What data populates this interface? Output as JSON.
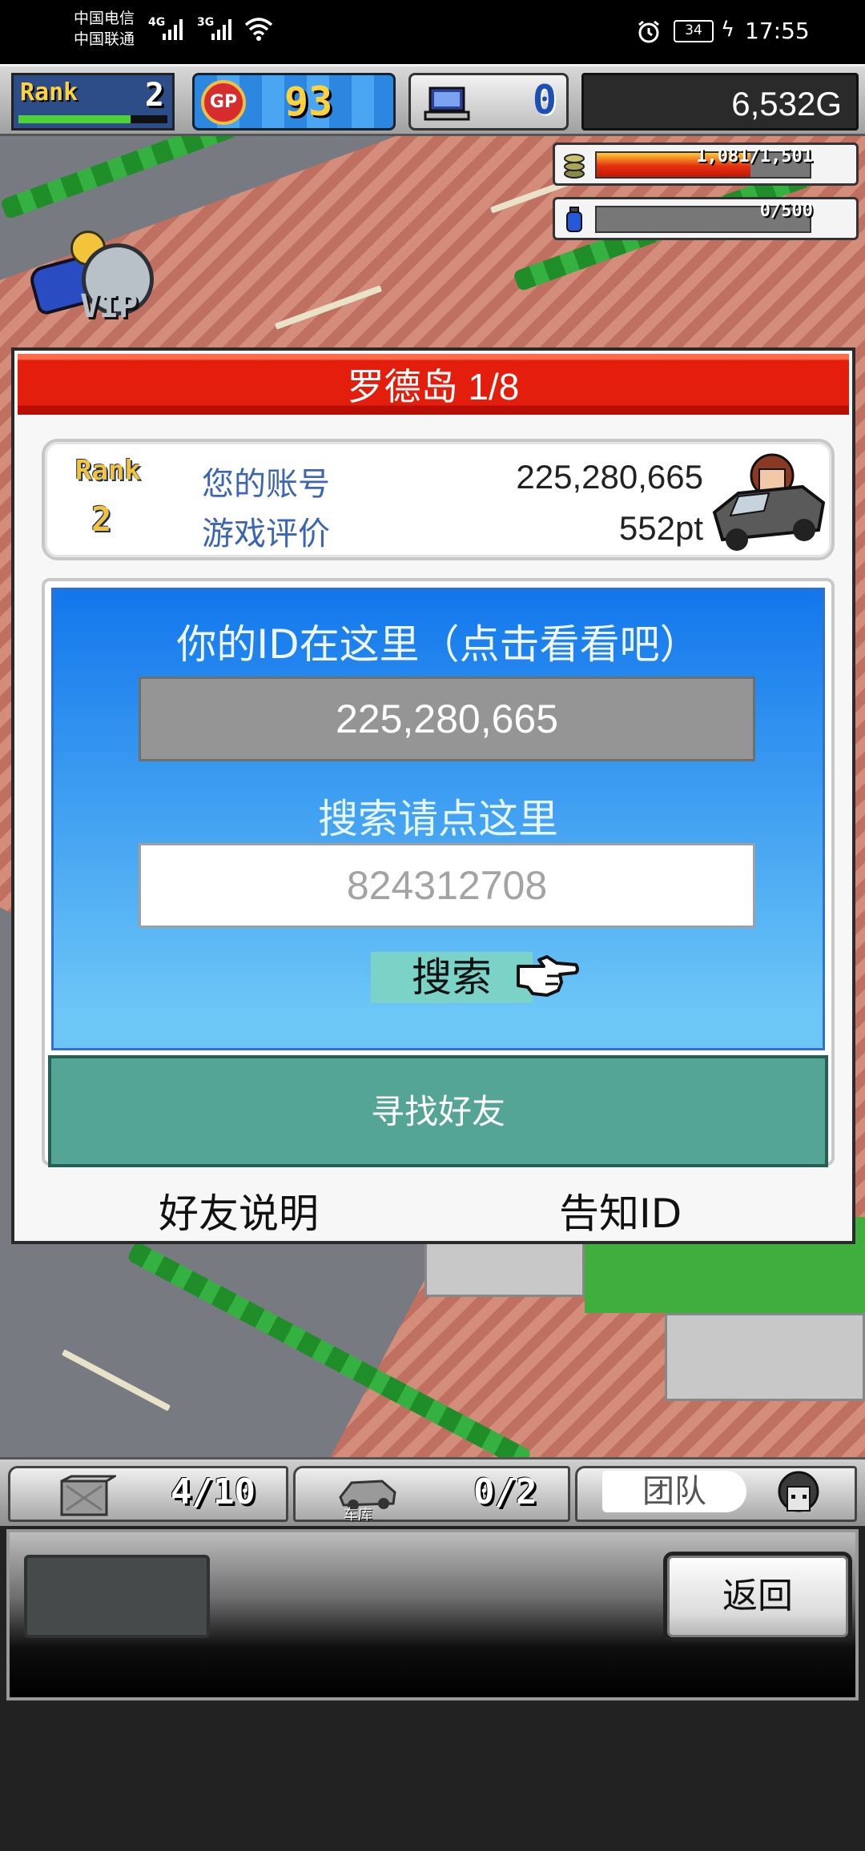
{
  "status_bar": {
    "carrier_1": "中国电信",
    "carrier_2": "中国联通",
    "network_1": "4G",
    "network_2": "3G",
    "battery": "34",
    "time": "17:55"
  },
  "hud": {
    "rank_label": "Rank",
    "rank_value": "2",
    "rank_progress": 0.75,
    "gp_icon_label": "GP",
    "gp_value": "93",
    "pc_value": "0",
    "money": "6,532G",
    "fuel_text": "1,081/1,501",
    "fuel_fraction": 0.72,
    "energy_text": "0/500",
    "energy_fraction": 0,
    "vip_label": "VIP"
  },
  "dialog": {
    "title": "罗德岛 1/8",
    "rank_label": "Rank",
    "rank_value": "2",
    "account_label": "您的账号",
    "account_value": "225,280,665",
    "rating_label": "游戏评价",
    "rating_value": "552pt",
    "id_caption": "你的ID在这里（点击看看吧）",
    "id_value": "225,280,665",
    "search_caption": "搜索请点这里",
    "search_placeholder": "824312708",
    "search_button": "搜索",
    "find_friend_button": "寻找好友",
    "friend_help": "好友说明",
    "share_id": "告知ID"
  },
  "bottom_bar": {
    "items_count": "4/10",
    "garage_label": "车库",
    "garage_count": "0/2",
    "team_tab": "团队"
  },
  "controls": {
    "back_button": "返回"
  },
  "colors": {
    "title_red": "#e41e0c",
    "panel_blue": "#1277ec",
    "find_friend_green": "#54a596",
    "label_blue": "#3c66b4"
  }
}
